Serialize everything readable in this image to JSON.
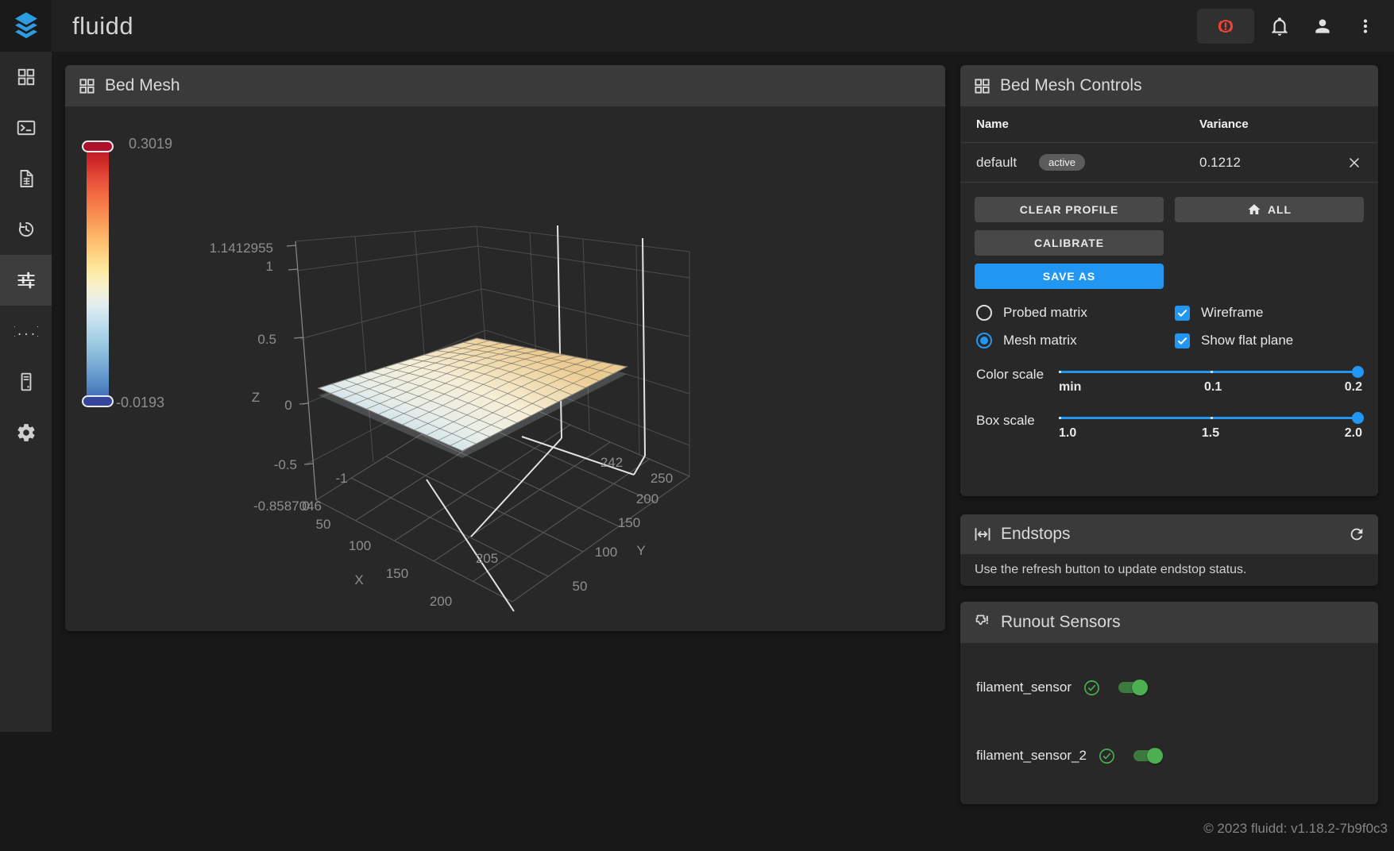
{
  "app": {
    "title": "fluidd",
    "footer": "© 2023 fluidd: v1.18.2-7b9f0c3"
  },
  "topbar": {
    "icons": [
      "emergency-stop",
      "notifications-bell",
      "user-account",
      "overflow-menu"
    ]
  },
  "sidebar": {
    "items": [
      {
        "name": "dashboard"
      },
      {
        "name": "console"
      },
      {
        "name": "jobs"
      },
      {
        "name": "history"
      },
      {
        "name": "tune",
        "active": true
      },
      {
        "name": "configure"
      },
      {
        "name": "system"
      },
      {
        "name": "settings"
      }
    ]
  },
  "bed_mesh": {
    "title": "Bed Mesh",
    "chart_data": {
      "type": "surface3d",
      "title": "Bed Mesh",
      "profile": "default",
      "variance": "0.1212",
      "colorbar": {
        "max": "0.3019",
        "min": "-0.0193"
      },
      "z_axis": {
        "label": "Z",
        "top": "1.1412955",
        "bottom": "-0.8587046",
        "ticks": [
          "1",
          "0.5",
          "0",
          "-0.5"
        ]
      },
      "x_axis": {
        "label": "X",
        "origin": "0",
        "ticks": [
          "50",
          "100",
          "150",
          "200"
        ],
        "bed_max": "205"
      },
      "y_axis": {
        "label": "Y",
        "min_tick": "-1",
        "ticks": [
          "50",
          "100",
          "150",
          "200",
          "250"
        ],
        "bed_max": "242"
      }
    }
  },
  "controls": {
    "title": "Bed Mesh Controls",
    "table": {
      "columns": [
        "Name",
        "Variance"
      ],
      "rows": [
        {
          "name": "default",
          "badge": "active",
          "variance": "0.1212"
        }
      ]
    },
    "buttons": {
      "clear_profile": "CLEAR PROFILE",
      "all": "ALL",
      "calibrate": "CALIBRATE",
      "save_as": "SAVE AS"
    },
    "options": {
      "probed_matrix": {
        "label": "Probed matrix",
        "selected": false
      },
      "mesh_matrix": {
        "label": "Mesh matrix",
        "selected": true
      },
      "wireframe": {
        "label": "Wireframe",
        "checked": true
      },
      "show_flat_plane": {
        "label": "Show flat plane",
        "checked": true
      }
    },
    "sliders": {
      "color_scale": {
        "label": "Color scale",
        "ticks": [
          "min",
          "0.1",
          "0.2"
        ],
        "value": "0.2"
      },
      "box_scale": {
        "label": "Box scale",
        "ticks": [
          "1.0",
          "1.5",
          "2.0"
        ],
        "value": "2.0"
      }
    }
  },
  "endstops": {
    "title": "Endstops",
    "message": "Use the refresh button to update endstop status."
  },
  "runout_sensors": {
    "title": "Runout Sensors",
    "sensors": [
      {
        "name": "filament_sensor",
        "enabled": true
      },
      {
        "name": "filament_sensor_2",
        "enabled": true
      }
    ]
  },
  "colors": {
    "accent": "#2196f3",
    "success": "#4caf50",
    "danger": "#f44336"
  }
}
